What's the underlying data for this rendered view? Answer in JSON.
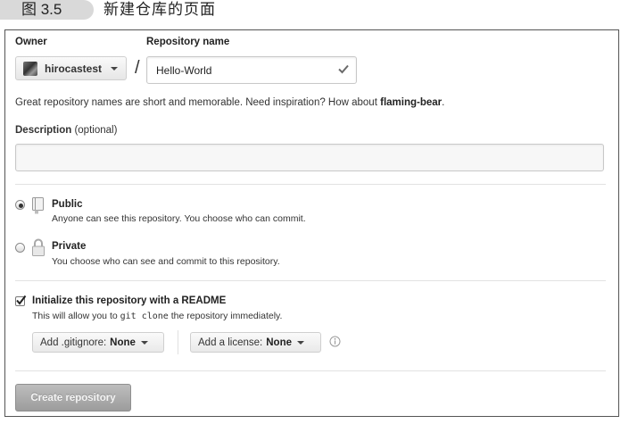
{
  "figure": {
    "number": "图 3.5",
    "title": "新建仓库的页面"
  },
  "owner": {
    "label": "Owner",
    "value": "hirocastest"
  },
  "separator": "/",
  "repository": {
    "label": "Repository name",
    "value": "Hello-World"
  },
  "hint": {
    "prefix": "Great repository names are short and memorable. Need inspiration? How about ",
    "suggestion": "flaming-bear",
    "suffix": "."
  },
  "description": {
    "label": "Description",
    "optional": " (optional)",
    "value": ""
  },
  "visibility": [
    {
      "title": "Public",
      "subtitle": "Anyone can see this repository. You choose who can commit.",
      "selected": true,
      "icon": "repo-book-icon"
    },
    {
      "title": "Private",
      "subtitle": "You choose who can see and commit to this repository.",
      "selected": false,
      "icon": "lock-icon"
    }
  ],
  "readme": {
    "checked": true,
    "title": "Initialize this repository with a README",
    "desc_prefix": "This will allow you to ",
    "desc_code": "git clone",
    "desc_suffix": " the repository immediately."
  },
  "gitignore": {
    "label": "Add .gitignore:",
    "value": "None"
  },
  "license": {
    "label": "Add a license:",
    "value": "None"
  },
  "submit_label": "Create repository",
  "colors": {
    "submit_disabled": "#a8a8a8",
    "valid_check": "#6a6a6a"
  }
}
